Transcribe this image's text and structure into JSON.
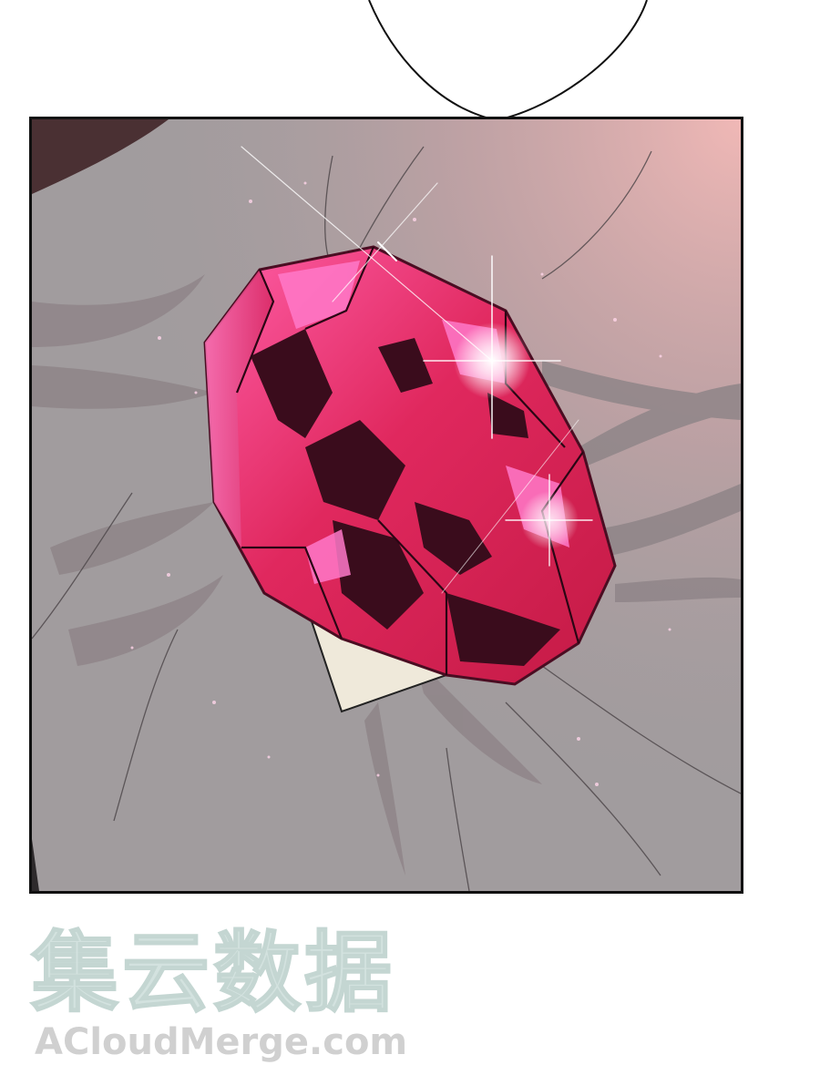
{
  "comic_page": {
    "panel": {
      "subject": "gemstone",
      "colors": {
        "gem": "#e0285e",
        "gem_highlight": "#ff6fc0",
        "gem_shadow": "#3a0c1c",
        "cloth": "#a19c9e",
        "corner_glow": "#e9b3b3",
        "border": "#111111"
      },
      "icons": [
        "sparkle-icon"
      ]
    },
    "watermark": {
      "cjk": "集云数据",
      "latin": "ACloudMerge.com",
      "color": "#d3e2df"
    }
  }
}
